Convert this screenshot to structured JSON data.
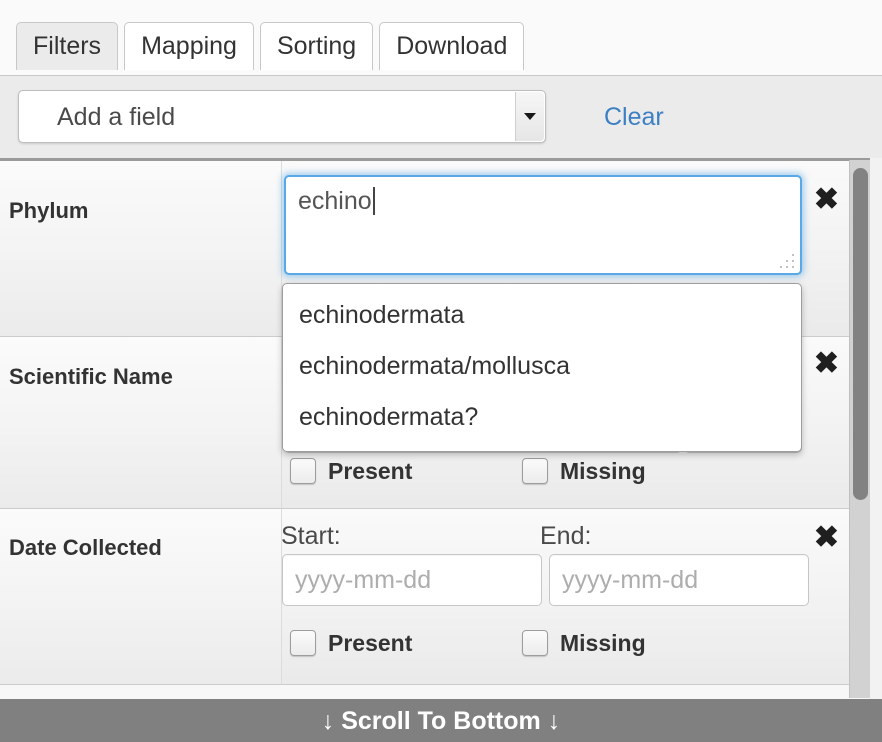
{
  "tabs": [
    {
      "label": "Filters",
      "active": true
    },
    {
      "label": "Mapping",
      "active": false
    },
    {
      "label": "Sorting",
      "active": false
    },
    {
      "label": "Download",
      "active": false
    }
  ],
  "toolbar": {
    "field_select_value": "Add a field",
    "clear_label": "Clear",
    "dropdown_icon": "chevron-down-icon"
  },
  "colors": {
    "accent_link": "#3b7fc4",
    "focus_ring": "#5aa9e6",
    "bottom_bar": "#808080",
    "row_border": "#cccccc",
    "scroll_thumb": "#828282"
  },
  "filters": [
    {
      "label": "Phylum",
      "value": "echino",
      "remove_icon": "close-icon",
      "resize_grip": "resize-grip-icon",
      "suggestions": [
        "echinodermata",
        "echinodermata/mollusca",
        "echinodermata?"
      ]
    },
    {
      "label": "Scientific Name",
      "value": "",
      "remove_icon": "close-icon",
      "resize_grip": "resize-grip-icon",
      "present_label": "Present",
      "missing_label": "Missing"
    },
    {
      "label": "Date Collected",
      "start_label": "Start:",
      "end_label": "End:",
      "start_placeholder": "yyyy-mm-dd",
      "end_placeholder": "yyyy-mm-dd",
      "start_value": "",
      "end_value": "",
      "remove_icon": "close-icon",
      "present_label": "Present",
      "missing_label": "Missing"
    }
  ],
  "bottom_bar": {
    "label": "↓ Scroll To Bottom ↓"
  }
}
